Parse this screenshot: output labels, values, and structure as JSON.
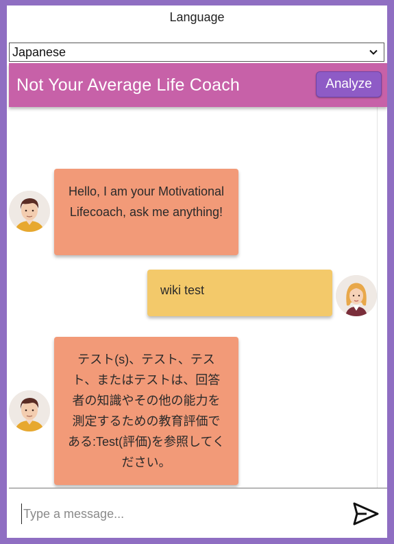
{
  "language": {
    "label": "Language",
    "selected": "Japanese"
  },
  "header": {
    "title": "Not Your Average Life Coach",
    "analyze_label": "Analyze"
  },
  "messages": [
    {
      "sender": "bot",
      "text": "Hello, I am your Motivational Lifecoach, ask me anything!"
    },
    {
      "sender": "user",
      "text": "wiki test"
    },
    {
      "sender": "bot",
      "text": "テスト(s)、テスト、テスト、またはテストは、回答者の知識やその他の能力を測定するための教育評価である:Test(評価)を参照してください。"
    }
  ],
  "composer": {
    "placeholder": "Type a message..."
  },
  "colors": {
    "border": "#8f6ec2",
    "header": "#c761a8",
    "analyze": "#8e5bc6",
    "bot_bubble": "#f29a78",
    "user_bubble": "#f3c96a"
  },
  "icons": {
    "dropdown": "chevron-down-icon",
    "send": "send-icon",
    "bot_avatar": "male-avatar",
    "user_avatar": "female-avatar"
  }
}
